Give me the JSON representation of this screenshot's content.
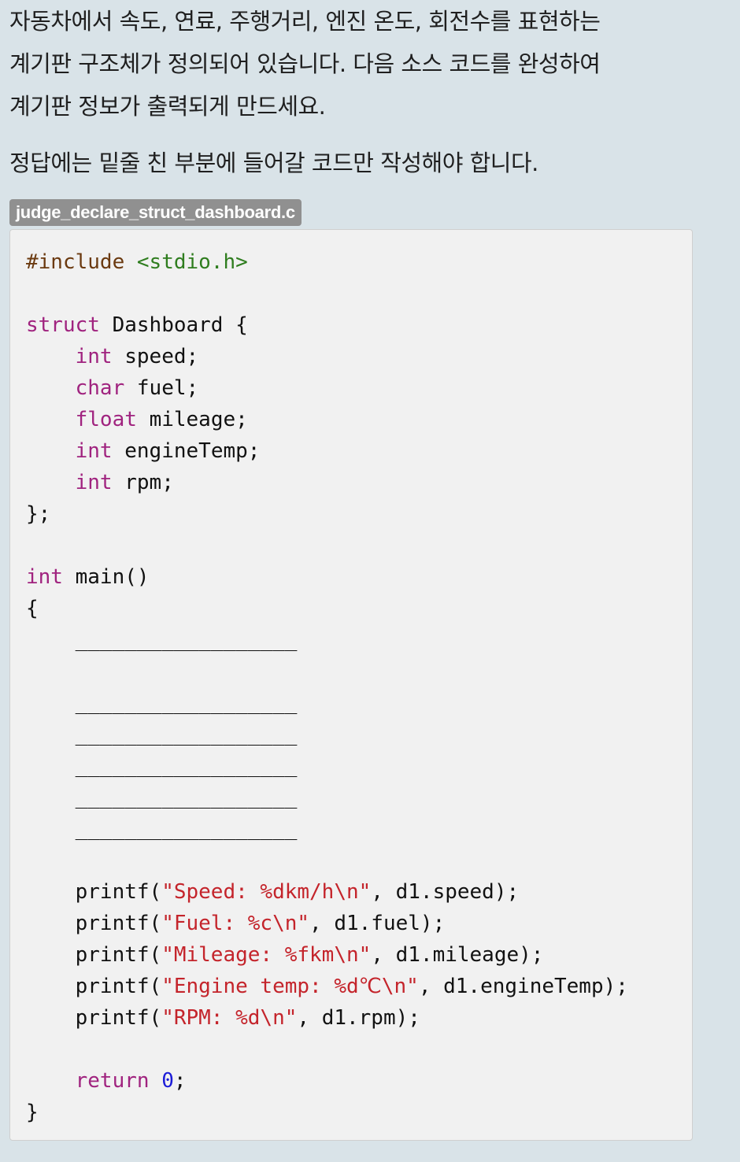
{
  "description": {
    "line1": "자동차에서 속도, 연료, 주행거리, 엔진 온도, 회전수를 표현하는",
    "line2": "계기판 구조체가 정의되어 있습니다. 다음 소스 코드를 완성하여",
    "line3": "계기판 정보가 출력되게 만드세요.",
    "note": "정답에는 밑줄 친 부분에 들어갈 코드만 작성해야 합니다."
  },
  "filename": "judge_declare_struct_dashboard.c",
  "code": {
    "include_directive": "#include",
    "include_header": "<stdio.h>",
    "struct_keyword": "struct",
    "struct_name": "Dashboard",
    "fields": [
      {
        "type": "int",
        "name": "speed"
      },
      {
        "type": "char",
        "name": "fuel"
      },
      {
        "type": "float",
        "name": "mileage"
      },
      {
        "type": "int",
        "name": "engineTemp"
      },
      {
        "type": "int",
        "name": "rpm"
      }
    ],
    "main_return_type": "int",
    "main_name": "main",
    "blank": "__________________",
    "printf_calls": [
      {
        "format": "\"Speed: %dkm/h\\n\"",
        "arg": "d1.speed"
      },
      {
        "format": "\"Fuel: %c\\n\"",
        "arg": "d1.fuel"
      },
      {
        "format": "\"Mileage: %fkm\\n\"",
        "arg": "d1.mileage"
      },
      {
        "format": "\"Engine temp: %d℃\\n\"",
        "arg": "d1.engineTemp"
      },
      {
        "format": "\"RPM: %d\\n\"",
        "arg": "d1.rpm"
      }
    ],
    "return_keyword": "return",
    "return_value": "0"
  }
}
